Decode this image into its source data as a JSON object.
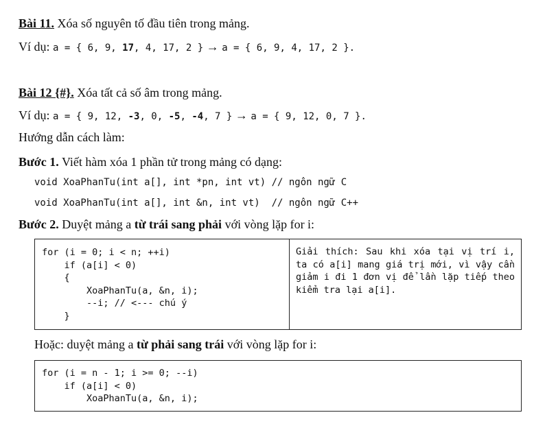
{
  "bai11": {
    "heading": "Bài 11.",
    "title": " Xóa số nguyên tố đầu tiên trong mảng.",
    "example_label": "Ví dụ: ",
    "ex_pre": "a = { 6, 9, ",
    "ex_bold": "17",
    "ex_mid": ", 4, 17, 2 }",
    "arrow": " → ",
    "ex_post": "a = { 6, 9, 4, 17, 2 }."
  },
  "bai12": {
    "heading": "Bài 12 {#}.",
    "title": " Xóa tất cả số âm trong mảng.",
    "example_label": "Ví dụ: ",
    "ex_a": "a = { 9, 12, ",
    "ex_b1": "-3",
    "ex_c": ", 0, ",
    "ex_b2": "-5",
    "ex_d": ", ",
    "ex_b3": "-4",
    "ex_e": ", 7 }",
    "arrow": " → ",
    "ex_post": "a = { 9, 12, 0, 7 }.",
    "guide": "Hướng dẫn cách làm:",
    "step1_label": "Bước 1.",
    "step1_text": " Viết hàm xóa 1 phần tử trong mảng có dạng:",
    "code_c": "void XoaPhanTu(int a[], int *pn, int vt) // ngôn ngữ C",
    "code_cpp": "void XoaPhanTu(int a[], int &n, int vt)  // ngôn ngữ C++",
    "step2_label": "Bước 2.",
    "step2_pre": " Duyệt mảng a ",
    "step2_bold": "từ trái sang phải",
    "step2_post": " với vòng lặp for i:",
    "box1_code": "for (i = 0; i < n; ++i)\n    if (a[i] < 0)\n    {\n        XoaPhanTu(a, &n, i);\n        --i; // <--- chú ý\n    }",
    "box1_expl": "Giải thích: Sau khi xóa tại vị trí i, ta có a[i] mang giá trị mới, vì vậy cần giảm i đi 1 đơn vị để lần lặp tiếp theo kiểm tra lại a[i].",
    "alt_pre": "Hoặc: duyệt mảng a ",
    "alt_bold": "từ phải sang trái",
    "alt_post": " với vòng lặp for i:",
    "box2_code": "for (i = n - 1; i >= 0; --i)\n    if (a[i] < 0)\n        XoaPhanTu(a, &n, i);"
  }
}
